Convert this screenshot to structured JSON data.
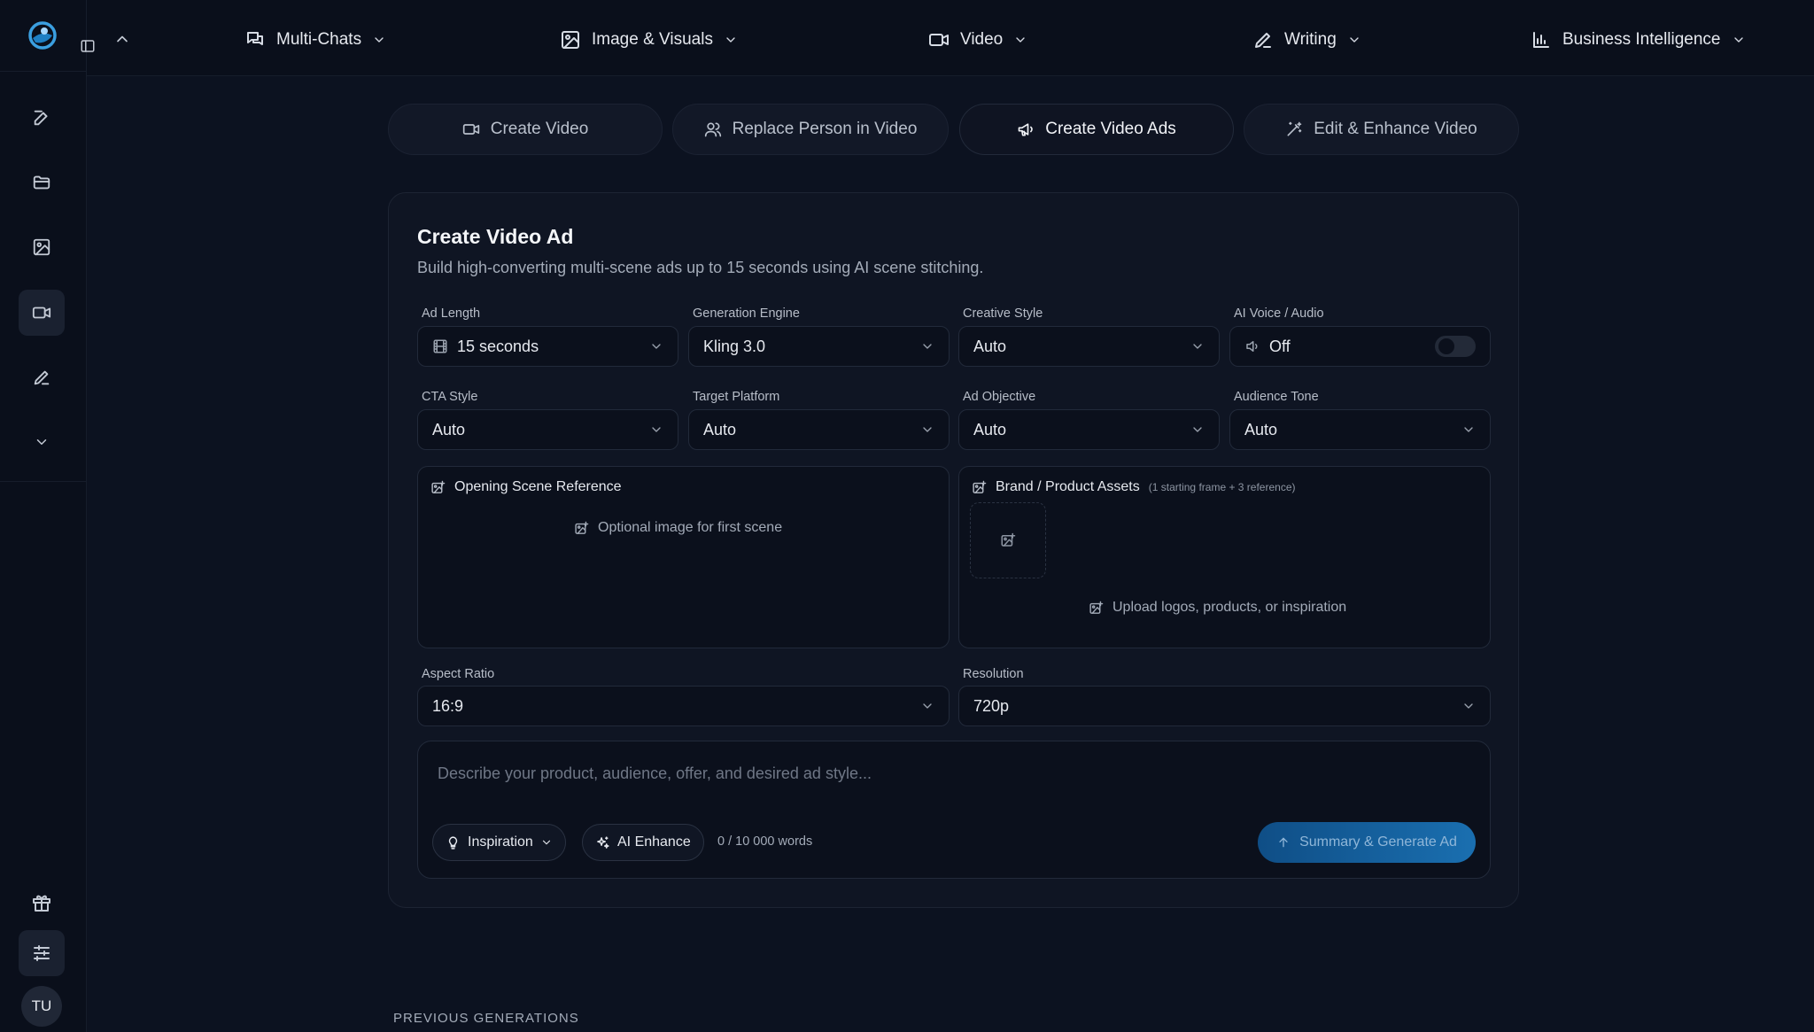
{
  "nav": {
    "items": [
      {
        "label": "Multi-Chats",
        "icon": "chat-icon"
      },
      {
        "label": "Image & Visuals",
        "icon": "image-icon"
      },
      {
        "label": "Video",
        "icon": "video-icon"
      },
      {
        "label": "Writing",
        "icon": "pen-icon"
      },
      {
        "label": "Business Intelligence",
        "icon": "bar-chart-icon"
      }
    ]
  },
  "sidebar": {
    "items": [
      {
        "name": "new-chat",
        "icon": "edit-icon"
      },
      {
        "name": "folders",
        "icon": "folder-icon"
      },
      {
        "name": "images",
        "icon": "image-icon"
      },
      {
        "name": "video",
        "icon": "video-icon",
        "active": true
      },
      {
        "name": "writing",
        "icon": "pen-icon"
      },
      {
        "name": "more",
        "icon": "chevron-down-icon"
      }
    ],
    "avatar_initials": "TU"
  },
  "tabs": [
    {
      "label": "Create Video",
      "icon": "video-icon"
    },
    {
      "label": "Replace Person in Video",
      "icon": "users-icon"
    },
    {
      "label": "Create Video Ads",
      "icon": "megaphone-icon",
      "active": true
    },
    {
      "label": "Edit & Enhance Video",
      "icon": "wand-icon"
    }
  ],
  "card": {
    "title": "Create Video Ad",
    "subtitle": "Build high-converting multi-scene ads up to 15 seconds using AI scene stitching.",
    "fields": {
      "ad_length": {
        "label": "Ad Length",
        "value": "15 seconds"
      },
      "generation_engine": {
        "label": "Generation Engine",
        "value": "Kling 3.0"
      },
      "creative_style": {
        "label": "Creative Style",
        "value": "Auto"
      },
      "ai_voice": {
        "label": "AI Voice / Audio",
        "value": "Off"
      },
      "cta_style": {
        "label": "CTA Style",
        "value": "Auto"
      },
      "target_platform": {
        "label": "Target Platform",
        "value": "Auto"
      },
      "ad_objective": {
        "label": "Ad Objective",
        "value": "Auto"
      },
      "audience_tone": {
        "label": "Audience Tone",
        "value": "Auto"
      },
      "aspect_ratio": {
        "label": "Aspect Ratio",
        "value": "16:9"
      },
      "resolution": {
        "label": "Resolution",
        "value": "720p"
      }
    },
    "opening_scene": {
      "title": "Opening Scene Reference",
      "hint": "Optional image for first scene"
    },
    "brand_assets": {
      "title": "Brand / Product Assets",
      "note": "(1 starting frame + 3 reference)",
      "hint": "Upload logos, products, or inspiration"
    },
    "prompt": {
      "placeholder": "Describe your product, audience, offer, and desired ad style...",
      "inspiration_label": "Inspiration",
      "enhance_label": "AI Enhance",
      "word_count": "0 / 10 000 words",
      "generate_label": "Summary & Generate Ad"
    }
  },
  "previous_generations_label": "PREVIOUS GENERATIONS",
  "colors": {
    "background": "#0c1220",
    "card": "#0f1523",
    "accent": "#1a6fb0"
  }
}
